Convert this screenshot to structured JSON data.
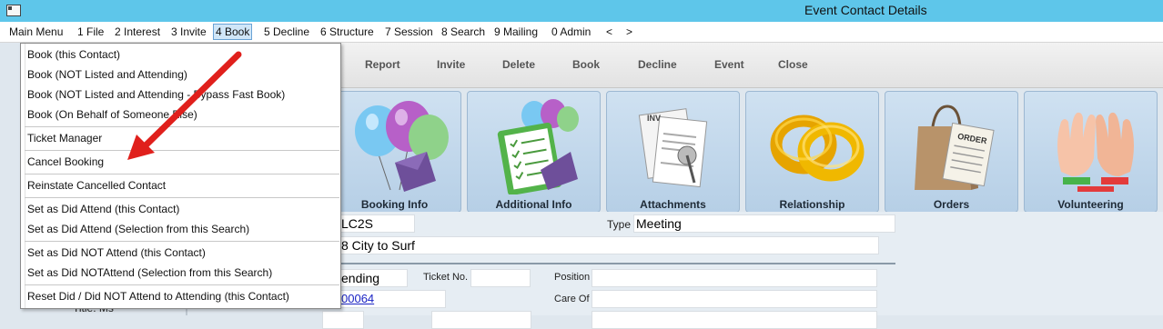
{
  "window": {
    "title": "Event Contact Details"
  },
  "menubar": {
    "items": [
      "Main Menu",
      "1 File",
      "2 Interest",
      "3 Invite",
      "4 Book",
      "5 Decline",
      "6 Structure",
      "7 Session",
      "8 Search",
      "9 Mailing",
      "0 Admin",
      "<",
      ">"
    ],
    "active": "4 Book"
  },
  "dropdown": {
    "items": [
      "Book (this Contact)",
      "Book (NOT Listed and Attending)",
      "Book (NOT Listed and Attending - Bypass Fast Book)",
      "Book (On Behalf of Someone Else)",
      "Ticket Manager",
      "Cancel Booking",
      "Reinstate Cancelled Contact",
      "Set as Did Attend (this Contact)",
      "Set as Did Attend (Selection from this Search)",
      "Set as Did NOT Attend (this Contact)",
      "Set as Did NOTAttend (Selection from this Search)",
      "Reset Did / Did NOT Attend to Attending (this Contact)"
    ]
  },
  "toolbar": {
    "report": "Report",
    "invite": "Invite",
    "delete": "Delete",
    "book": "Book",
    "decline": "Decline",
    "event": "Event",
    "close": "Close"
  },
  "tiles": [
    "Booking Info",
    "Additional Info",
    "Attachments",
    "Relationship",
    "Orders",
    "Volunteering"
  ],
  "details": {
    "code_value": "LC2S",
    "type_label": "Type",
    "type_value": "Meeting",
    "event_name": "8 City to Surf",
    "status_value": "ending",
    "ticket_label": "Ticket No.",
    "ticket_value": "",
    "position_label": "Position",
    "position_value": "",
    "link_value": "00064",
    "careof_label": "Care Of",
    "careof_value": ""
  },
  "leftpanel": {
    "title_text": "Title: Ms"
  },
  "colors": {
    "titlebar": "#5ec6ea",
    "arrow": "#e0201c",
    "link": "#1a23c4"
  }
}
